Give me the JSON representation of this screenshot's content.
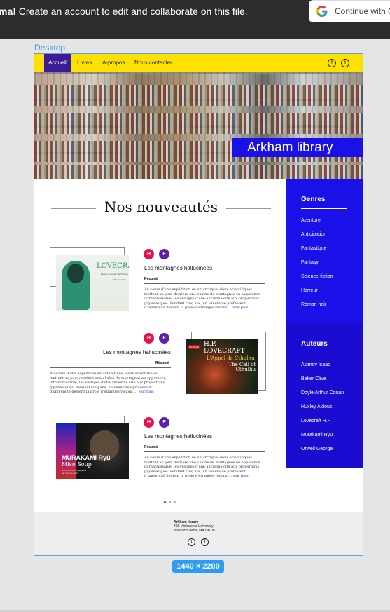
{
  "banner": {
    "bold": "ma!",
    "text": " Create an account to edit and collaborate on this file.",
    "google_button": "Continue with G"
  },
  "frame": {
    "label": "Desktop",
    "size_badge": "1440 × 2200"
  },
  "nav": {
    "items": [
      "Accueil",
      "Livres",
      "A-propos",
      "Nous contacter"
    ],
    "active": "Accueil",
    "social": [
      "facebook-icon",
      "twitter-icon"
    ]
  },
  "hero": {
    "title": "Arkham library"
  },
  "main": {
    "title": "Nos nouveautés",
    "books": [
      {
        "avatars": [
          "H",
          "F"
        ],
        "title": "Les montagnes hallucinées",
        "resume_label": "Résumé",
        "resume": "Au cours d'une expédition en antarctique, deux scientifiques mettent au jour, derrière une chaîne de montagnes en apparence infranchissable, les vestiges d'une ancienne cité aux proportions gigantesques. Pendant cinq ans, un vénérable professeur d'université devient la proie d'étranges visions ...",
        "more": "voir plus",
        "cover": {
          "title": "LOVECRAFT",
          "subtitle": "Épopée marquée de l'horreur",
          "author": "H.P. Lovecraft"
        }
      },
      {
        "avatars": [
          "H",
          "F"
        ],
        "title": "Les montagnes hallucinées",
        "resume_label": "Résumé",
        "resume": "Au cours d'une expédition en antarctique, deux scientifiques mettent au jour, derrière une chaîne de montagnes en apparence infranchissable, les vestiges d'une ancienne cité aux proportions gigantesques. Pendant cinq ans, un vénérable professeur d'université devient la proie d'étranges visions ...",
        "more": "voir plus",
        "cover": {
          "badge": "BILINGUE",
          "author": "H.P. LOVECRAFT",
          "title_fr": "L'Appel de Cthulhu",
          "title_en": "The Call of Cthulhu"
        }
      },
      {
        "avatars": [
          "H",
          "F"
        ],
        "title": "Les montagnes hallucinées",
        "resume_label": "Résumé",
        "resume": "Au cours d'une expédition en antarctique, deux scientifiques mettent au jour, derrière une chaîne de montagnes en apparence infranchissable, les vestiges d'une ancienne cité aux proportions gigantesques. Pendant cinq ans, un vénérable professeur d'université devient la proie d'étranges visions ...",
        "more": "voir plus",
        "cover": {
          "author": "MURAKAMI Ryû",
          "title": "Miso Soup",
          "credit": "Roman traduit du japonais par Corinne Atlan"
        }
      }
    ]
  },
  "sidebar": {
    "genres_title": "Genres",
    "genres": [
      "Aventure",
      "Anticipation",
      "Fantastique",
      "Fantasy",
      "Science-fiction",
      "Horreur",
      "Roman noir"
    ],
    "auteurs_title": "Auteurs",
    "auteurs": [
      "Asimov Isaac",
      "Baker Clive",
      "Doyle Arthur Conan",
      "Huxley Aldous",
      "Lovecraft H.P",
      "Murakami Ryu",
      "Orwell George"
    ]
  },
  "footer": {
    "name": "Arkham library",
    "address1": "455 Miskatonic University",
    "address2": "Massachusetts, MA 09108"
  },
  "colors": {
    "accent": "#1a10e8",
    "nav": "#ffe100",
    "avatar_h": "#e8114d",
    "avatar_f": "#5b22a6"
  }
}
